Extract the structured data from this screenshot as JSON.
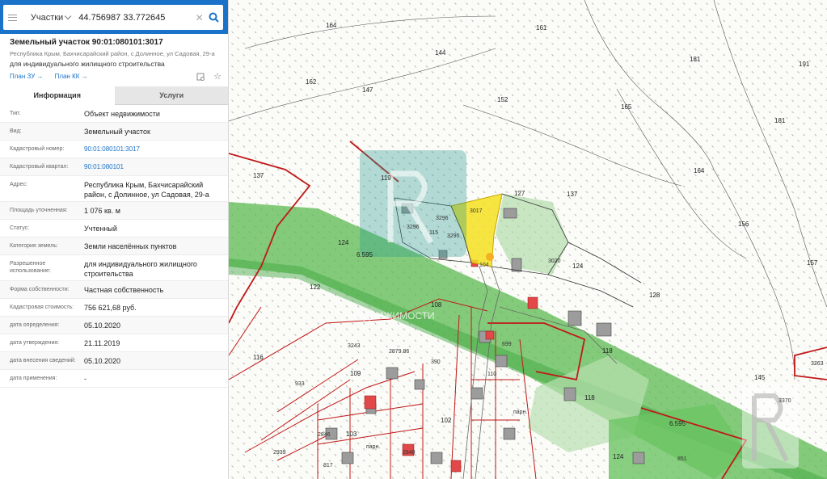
{
  "search": {
    "layer": "Участки",
    "query": "44.756987 33.772645"
  },
  "card": {
    "title": "Земельный участок 90:01:080101:3017",
    "address": "Республика Крым, Бахчисарайский район, с Долинное, ул Садовая, 29-а",
    "purpose": "для индивидуального жилищного строительства",
    "link_plan_zu": "План ЗУ →",
    "link_plan_kk": "План КК →"
  },
  "tabs": {
    "info": "Информация",
    "services": "Услуги"
  },
  "properties": [
    {
      "key": "Тип:",
      "value": "Объект недвижимости"
    },
    {
      "key": "Вид:",
      "value": "Земельный участок"
    },
    {
      "key": "Кадастровый номер:",
      "value": "90:01:080101:3017"
    },
    {
      "key": "Кадастровый квартал:",
      "value": "90:01:080101"
    },
    {
      "key": "Адрес:",
      "value": "Республика Крым, Бахчисарайский район, с Долинное, ул Садовая, 29-а"
    },
    {
      "key": "Площадь уточненная:",
      "value": "1 076 кв. м"
    },
    {
      "key": "Статус:",
      "value": "Учтенный"
    },
    {
      "key": "Категория земель:",
      "value": "Земли населённых пунктов"
    },
    {
      "key": "Разрешенное использование:",
      "value": "для индивидуального жилищного строительства"
    },
    {
      "key": "Форма собственности:",
      "value": "Частная собственность"
    },
    {
      "key": "Кадастровая стоимость:",
      "value": "756 621,68 руб."
    },
    {
      "key": "дата определения:",
      "value": "05.10.2020"
    },
    {
      "key": "дата утверждения:",
      "value": "21.11.2019"
    },
    {
      "key": "дата внесения сведений:",
      "value": "05.10.2020"
    },
    {
      "key": "дата применения:",
      "value": "-"
    }
  ],
  "map": {
    "labels": {
      "l164a": "164",
      "l161": "161",
      "l144": "144",
      "l181": "181",
      "l191": "191",
      "l162": "162",
      "l147": "147",
      "l152": "152",
      "l165": "165",
      "l181b": "181",
      "l137a": "137",
      "l119": "119",
      "l127": "127",
      "l137b": "137",
      "l164b": "164",
      "l156": "156",
      "l157": "157",
      "l124a": "124",
      "l6595a": "6.595",
      "l124b": "124",
      "l122": "122",
      "l128": "128",
      "l108": "108",
      "l118a": "118",
      "l116": "116",
      "l3243": "3243",
      "l2879": "2879.86",
      "l390": "390",
      "l699": "699",
      "l110": "110",
      "l933": "933",
      "l109": "109",
      "l118b": "118",
      "l145": "145",
      "l3263": "3263",
      "l6595b": "6.595",
      "l851": "851",
      "l124c": "124",
      "l2846": "2846",
      "l103": "103",
      "l2939": "2939",
      "l817": "817",
      "l102": "102",
      "l3017": "3017",
      "l3296a": "3296",
      "l3295": "3295",
      "l3296b": "3296",
      "l115": "115",
      "l104": "104",
      "lparn1": "парн.",
      "lparn2": "парн.",
      "l2840": "2840",
      "l3020": "3020",
      "l3370": "3370"
    },
    "watermark_text": "НЕДВИЖИМОСТИ"
  }
}
